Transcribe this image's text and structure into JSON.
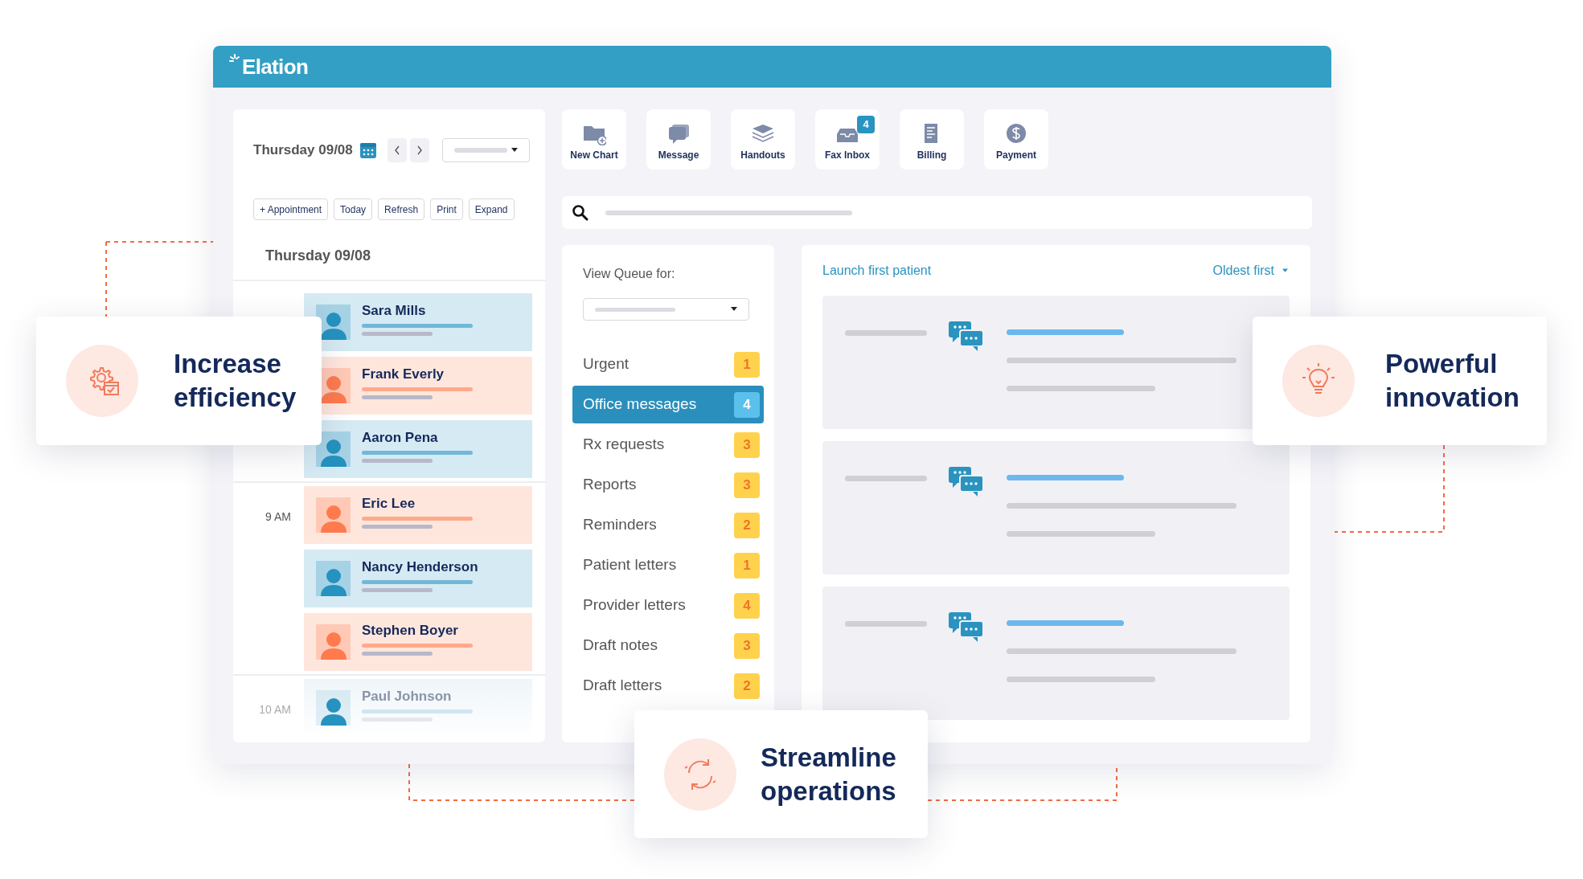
{
  "app": {
    "logo": "Elation"
  },
  "schedule": {
    "date_title": "Thursday 09/08",
    "actions": [
      "+ Appointment",
      "Today",
      "Refresh",
      "Print",
      "Expand"
    ],
    "day_heading": "Thursday 09/08",
    "groups": [
      {
        "faded": false,
        "patients": [
          {
            "name": "Sara Mills",
            "color": "#2592bf"
          },
          {
            "name": "Frank Everly",
            "color": "#ff7a4d"
          },
          {
            "name": "Aaron Pena",
            "color": "#2592bf"
          }
        ]
      },
      {
        "time": "9 AM",
        "faded": false,
        "patients": [
          {
            "name": "Eric Lee",
            "color": "#ff7a4d"
          },
          {
            "name": "Nancy Henderson",
            "color": "#2592bf"
          },
          {
            "name": "Stephen Boyer",
            "color": "#ff7a4d"
          }
        ]
      },
      {
        "time": "10 AM",
        "faded": true,
        "patients": [
          {
            "name": "Paul Johnson",
            "color": "#2592bf"
          }
        ]
      }
    ]
  },
  "toolbar": [
    {
      "label": "New Chart",
      "kind": "folder"
    },
    {
      "label": "Message",
      "kind": "message"
    },
    {
      "label": "Handouts",
      "kind": "layers"
    },
    {
      "label": "Fax Inbox",
      "kind": "inbox",
      "badge": "4"
    },
    {
      "label": "Billing",
      "kind": "bill"
    },
    {
      "label": "Payment",
      "kind": "payment"
    }
  ],
  "queue": {
    "label": "View Queue for:",
    "items": [
      {
        "label": "Urgent",
        "count": "1",
        "selected": false
      },
      {
        "label": "Office messages",
        "count": "4",
        "selected": true
      },
      {
        "label": "Rx requests",
        "count": "3",
        "selected": false
      },
      {
        "label": "Reports",
        "count": "3",
        "selected": false
      },
      {
        "label": "Reminders",
        "count": "2",
        "selected": false
      },
      {
        "label": "Patient letters",
        "count": "1",
        "selected": false
      },
      {
        "label": "Provider letters",
        "count": "4",
        "selected": false
      },
      {
        "label": "Draft notes",
        "count": "3",
        "selected": false
      },
      {
        "label": "Draft letters",
        "count": "2",
        "selected": false
      }
    ]
  },
  "messages": {
    "launch": "Launch first patient",
    "sort": "Oldest first",
    "cards": [
      {
        "kind": "chat"
      },
      {
        "kind": "chat"
      },
      {
        "kind": "chat"
      }
    ]
  },
  "features": [
    {
      "title": "Increase efficiency",
      "kind": "gear"
    },
    {
      "title": "Powerful innovation",
      "kind": "bulb"
    },
    {
      "title": "Streamline operations",
      "kind": "cycle"
    }
  ]
}
